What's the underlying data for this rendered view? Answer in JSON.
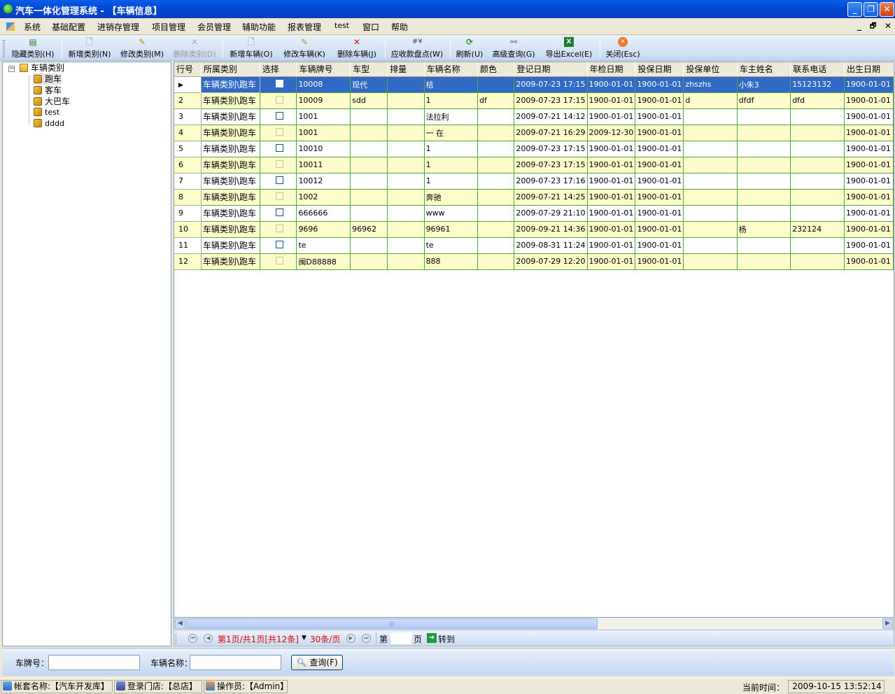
{
  "window": {
    "title": "汽车一体化管理系统 - 【车辆信息】",
    "controls": {
      "minimize": "_",
      "restore": "❐",
      "close": "✕"
    }
  },
  "menu": {
    "items": [
      "系统",
      "基础配置",
      "进销存管理",
      "项目管理",
      "会员管理",
      "辅助功能",
      "报表管理",
      "test",
      "窗口",
      "帮助"
    ],
    "mdi_controls": [
      "_",
      "🗗",
      "✕"
    ]
  },
  "toolbar": {
    "buttons": [
      {
        "label": "隐藏类别(H)",
        "icon": "hide-category-icon",
        "enabled": true
      },
      {
        "label": "新增类别(N)",
        "icon": "new-document-icon",
        "enabled": true
      },
      {
        "label": "修改类别(M)",
        "icon": "edit-document-icon",
        "enabled": true
      },
      {
        "label": "删除类别(D)",
        "icon": "delete-icon",
        "enabled": false
      },
      {
        "label": "新增车辆(O)",
        "icon": "new-document-icon",
        "enabled": true
      },
      {
        "label": "修改车辆(K)",
        "icon": "edit-document-icon",
        "enabled": true
      },
      {
        "label": "删除车辆(J)",
        "icon": "delete-icon",
        "enabled": true
      },
      {
        "label": "应收款盘点(W)",
        "icon": "count-icon",
        "enabled": true
      },
      {
        "label": "刷新(U)",
        "icon": "refresh-icon",
        "enabled": true
      },
      {
        "label": "高级查询(G)",
        "icon": "binoculars-icon",
        "enabled": true
      },
      {
        "label": "导出Excel(E)",
        "icon": "excel-icon",
        "enabled": true
      },
      {
        "label": "关闭(Esc)",
        "icon": "close-circle-icon",
        "enabled": true
      }
    ]
  },
  "tree": {
    "root": "车辆类别",
    "children": [
      "跑车",
      "客车",
      "大巴车",
      "test",
      "dddd"
    ],
    "selected": "跑车"
  },
  "grid": {
    "columns": [
      "行号",
      "所属类别",
      "选择",
      "车辆牌号",
      "车型",
      "排量",
      "车辆名称",
      "颜色",
      "登记日期",
      "年检日期",
      "投保日期",
      "投保单位",
      "车主姓名",
      "联系电话",
      "出生日期"
    ],
    "rows": [
      [
        "",
        "车辆类别\\跑车",
        "",
        "10008",
        "现代",
        "",
        "桔",
        "",
        "2009-07-23 17:15",
        "1900-01-01",
        "1900-01-01",
        "zhszhs",
        "小朱3",
        "15123132",
        "1900-01-01"
      ],
      [
        "2",
        "车辆类别\\跑车",
        "",
        "10009",
        "sdd",
        "",
        "1",
        "df",
        "2009-07-23 17:15",
        "1900-01-01",
        "1900-01-01",
        "d",
        "dfdf",
        "dfd",
        "1900-01-01"
      ],
      [
        "3",
        "车辆类别\\跑车",
        "",
        "1001",
        "",
        "",
        "法拉利",
        "",
        "2009-07-21 14:12",
        "1900-01-01",
        "1900-01-01",
        "",
        "",
        "",
        "1900-01-01"
      ],
      [
        "4",
        "车辆类别\\跑车",
        "",
        "1001",
        "",
        "",
        "一 在",
        "",
        "2009-07-21 16:29",
        "2009-12-30",
        "1900-01-01",
        "",
        "",
        "",
        "1900-01-01"
      ],
      [
        "5",
        "车辆类别\\跑车",
        "",
        "10010",
        "",
        "",
        "1",
        "",
        "2009-07-23 17:15",
        "1900-01-01",
        "1900-01-01",
        "",
        "",
        "",
        "1900-01-01"
      ],
      [
        "6",
        "车辆类别\\跑车",
        "",
        "10011",
        "",
        "",
        "1",
        "",
        "2009-07-23 17:15",
        "1900-01-01",
        "1900-01-01",
        "",
        "",
        "",
        "1900-01-01"
      ],
      [
        "7",
        "车辆类别\\跑车",
        "",
        "10012",
        "",
        "",
        "1",
        "",
        "2009-07-23 17:16",
        "1900-01-01",
        "1900-01-01",
        "",
        "",
        "",
        "1900-01-01"
      ],
      [
        "8",
        "车辆类别\\跑车",
        "",
        "1002",
        "",
        "",
        "奔驰",
        "",
        "2009-07-21 14:25",
        "1900-01-01",
        "1900-01-01",
        "",
        "",
        "",
        "1900-01-01"
      ],
      [
        "9",
        "车辆类别\\跑车",
        "",
        "666666",
        "",
        "",
        "www",
        "",
        "2009-07-29 21:10",
        "1900-01-01",
        "1900-01-01",
        "",
        "",
        "",
        "1900-01-01"
      ],
      [
        "10",
        "车辆类别\\跑车",
        "",
        "9696",
        "96962",
        "",
        "96961",
        "",
        "2009-09-21 14:36",
        "1900-01-01",
        "1900-01-01",
        "",
        "杨",
        "232124",
        "1900-01-01"
      ],
      [
        "11",
        "车辆类别\\跑车",
        "",
        "te",
        "",
        "",
        "te",
        "",
        "2009-08-31 11:24",
        "1900-01-01",
        "1900-01-01",
        "",
        "",
        "",
        "1900-01-01"
      ],
      [
        "12",
        "车辆类别\\跑车",
        "",
        "闽D88888",
        "",
        "",
        "888",
        "",
        "2009-07-29 12:20",
        "1900-01-01",
        "1900-01-01",
        "",
        "",
        "",
        "1900-01-01"
      ]
    ],
    "selected_row": 0
  },
  "pager": {
    "summary": "第1页/共1页[共12条]",
    "page_size": "30条/页",
    "page_prefix": "第",
    "page_suffix": "页",
    "goto": "转到",
    "colors": {
      "summary": "#e00000"
    }
  },
  "search": {
    "plate_label": "车牌号：",
    "name_label": "车辆名称：",
    "plate_value": "",
    "name_value": "",
    "query_button": "查询(F)"
  },
  "status": {
    "account": "帐套名称:【汽车开发库】",
    "store": "登录门店:【总店】",
    "operator": "操作员:【Admin】",
    "time_label": "当前时间：",
    "time_value": "2009-10-15 13:52:14"
  }
}
